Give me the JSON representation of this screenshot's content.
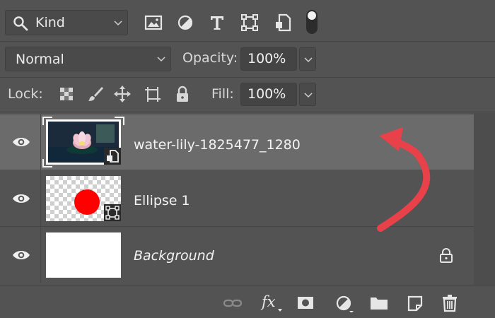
{
  "filter": {
    "kind_label": "Kind",
    "icons": [
      "image-filter-icon",
      "adjustment-filter-icon",
      "type-filter-icon",
      "shape-filter-icon",
      "smart-object-filter-icon"
    ],
    "type_glyph": "T"
  },
  "blend": {
    "mode": "Normal",
    "opacity_label": "Opacity:",
    "opacity_value": "100%"
  },
  "lock": {
    "label": "Lock:",
    "fill_label": "Fill:",
    "fill_value": "100%",
    "icons": [
      "lock-transparent-pixels-icon",
      "lock-image-pixels-icon",
      "lock-position-icon",
      "lock-artboard-icon",
      "lock-all-icon"
    ]
  },
  "layers": [
    {
      "name": "water-lily-1825477_1280",
      "selected": true,
      "italic": false,
      "thumb": "water-lily-photo",
      "badge": "smart-object-badge-icon"
    },
    {
      "name": "Ellipse 1",
      "selected": false,
      "italic": false,
      "thumb": "red-ellipse",
      "badge": "shape-badge-icon"
    },
    {
      "name": "Background",
      "selected": false,
      "italic": true,
      "thumb": "white",
      "badge": "background-lock-icon"
    }
  ],
  "toolbar": {
    "fx_label": "fx",
    "icons": [
      "link-layers-icon",
      "layer-style-icon",
      "add-mask-icon",
      "adjustment-layer-icon",
      "new-group-icon",
      "new-layer-icon",
      "delete-layer-icon"
    ]
  },
  "colors": {
    "panel_bg": "#535353",
    "selected_row": "#6b6b6b",
    "annotation_arrow": "#e8414a",
    "ellipse_fill": "#ff0000"
  }
}
